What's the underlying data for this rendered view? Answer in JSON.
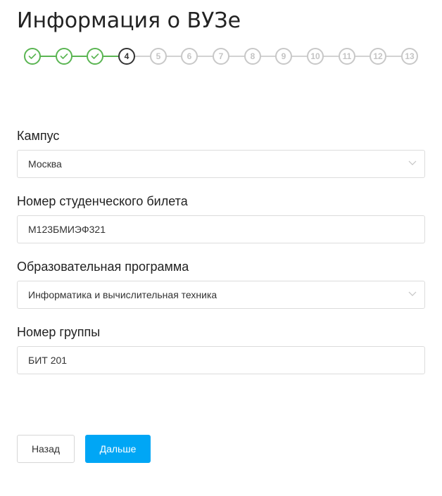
{
  "page": {
    "title": "Информация о ВУЗе"
  },
  "stepper": {
    "current_step": 4,
    "total_steps": 13,
    "colors": {
      "done": "#5ab552",
      "current": "#333333",
      "pending": "#c8c8c8"
    },
    "steps": [
      {
        "label": "1",
        "state": "done",
        "icon": "check-icon"
      },
      {
        "label": "2",
        "state": "done",
        "icon": "check-icon"
      },
      {
        "label": "3",
        "state": "done",
        "icon": "check-icon"
      },
      {
        "label": "4",
        "state": "current"
      },
      {
        "label": "5",
        "state": "pending"
      },
      {
        "label": "6",
        "state": "pending"
      },
      {
        "label": "7",
        "state": "pending"
      },
      {
        "label": "8",
        "state": "pending"
      },
      {
        "label": "9",
        "state": "pending"
      },
      {
        "label": "10",
        "state": "pending"
      },
      {
        "label": "11",
        "state": "pending"
      },
      {
        "label": "12",
        "state": "pending"
      },
      {
        "label": "13",
        "state": "pending"
      }
    ]
  },
  "form": {
    "campus": {
      "label": "Кампус",
      "value": "Москва",
      "icon": "chevron-down-icon"
    },
    "student_id": {
      "label": "Номер студенческого билета",
      "value": "М123БМИЭФ321"
    },
    "program": {
      "label": "Образовательная программа",
      "value": "Информатика и вычислительная техника",
      "icon": "chevron-down-icon"
    },
    "group": {
      "label": "Номер группы",
      "value": "БИТ 201"
    }
  },
  "actions": {
    "back_label": "Назад",
    "next_label": "Дальше",
    "accent_color": "#00a6f5"
  }
}
